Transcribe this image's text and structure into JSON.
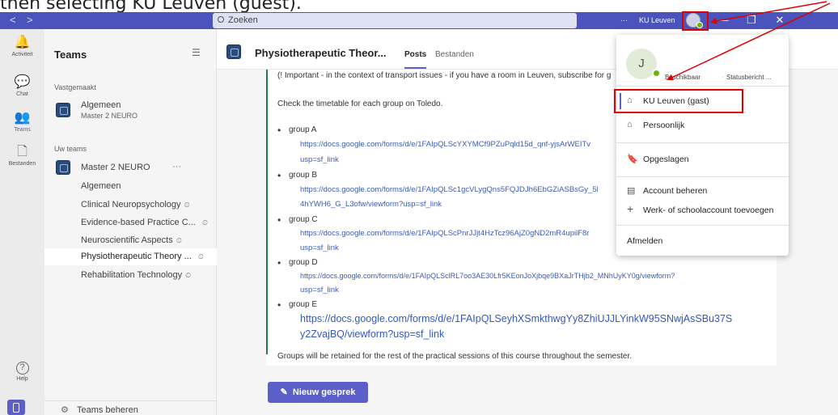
{
  "caption": "then selecting KU Leuven (guest).",
  "titlebar": {
    "back": "<",
    "forward": ">",
    "search_placeholder": "Zoeken",
    "more": "···",
    "org_name": "KU Leuven",
    "minimize": "—",
    "restore": "❐",
    "close": "✕"
  },
  "rail": {
    "items": [
      {
        "label": "Activiteit",
        "icon": "bell-icon",
        "glyph": "🔔"
      },
      {
        "label": "Chat",
        "icon": "chat-icon",
        "glyph": "💬"
      },
      {
        "label": "Teams",
        "icon": "teams-icon",
        "glyph": "👥"
      },
      {
        "label": "Bestanden",
        "icon": "file-icon",
        "glyph": "🗋"
      }
    ],
    "help": "Help",
    "help_glyph": "?"
  },
  "sidebar": {
    "title": "Teams",
    "filter_glyph": "☰",
    "pinned_label": "Vastgemaakt",
    "pinned": {
      "title": "Algemeen",
      "subtitle": "Master 2 NEURO"
    },
    "your_teams_label": "Uw teams",
    "team": {
      "name": "Master 2 NEURO",
      "more": "···"
    },
    "channels": [
      {
        "label": "Algemeen",
        "lock": ""
      },
      {
        "label": "Clinical Neuropsychology",
        "lock": "⏲"
      },
      {
        "label": "Evidence-based Practice C...",
        "lock": "⏲"
      },
      {
        "label": "Neuroscientific Aspects",
        "lock": "⏲"
      },
      {
        "label": "Physiotherapeutic Theory ...",
        "lock": "⏲"
      },
      {
        "label": "Rehabilitation Technology",
        "lock": "⏲"
      }
    ],
    "manage_label": "Teams beheren",
    "manage_glyph": "⚙"
  },
  "channel": {
    "title": "Physiotherapeutic Theor...",
    "tabs": [
      "Posts",
      "Bestanden"
    ]
  },
  "post": {
    "intro": "(! Important - in the context of transport issues - if you have a room in Leuven, subscribe for g",
    "timetable": "Check the timetable for each group on Toledo.",
    "groups": [
      {
        "name": "group A",
        "link1": "https://docs.google.com/forms/d/e/1FAIpQLScYXYMCf9PZuPqld15d_qnf-yjsArWEITv",
        "link2": "usp=sf_link"
      },
      {
        "name": "group B",
        "link1": "https://docs.google.com/forms/d/e/1FAIpQLSc1gcVLygQns5FQJDJh6EbGZiASBsGy_5l",
        "link2": "4hYWH6_G_L3ofw/viewform?usp=sf_link"
      },
      {
        "name": "group C",
        "link1": "https://docs.google.com/forms/d/e/1FAIpQLScPnrJJjt4HzTcz96AjZ0gND2mR4upilF8r",
        "link2": "usp=sf_link"
      },
      {
        "name": "group D",
        "link1": "https://docs.google.com/forms/d/e/1FAIpQLSclRL7oo3AE30Lfr5KEonJoXjbqe9BXaJrTHjb2_MNhUyKY0g/viewform?",
        "link2": "usp=sf_link"
      },
      {
        "name": "group E",
        "link1": "https://docs.google.com/forms/d/e/1FAIpQLSeyhXSmkthwgYy8ZhiUJJLYinkW95SNwjAsSBu37S",
        "link2": "y2ZvajBQ/viewform?usp=sf_link"
      }
    ],
    "footer": "Groups will be retained for the rest of the practical sessions of this course throughout the semester."
  },
  "new_conversation": {
    "glyph": "✎",
    "label": "Nieuw gesprek"
  },
  "account_menu": {
    "initial": "J",
    "status": "Beschikbaar",
    "status_message": "Statusbericht ...",
    "accounts": [
      {
        "label": "KU Leuven (gast)",
        "glyph": "⌂"
      },
      {
        "label": "Persoonlijk",
        "glyph": "⌂"
      }
    ],
    "saved": {
      "label": "Opgeslagen",
      "glyph": "🔖"
    },
    "manage_account": {
      "label": "Account beheren",
      "glyph": "▤"
    },
    "add_account": {
      "label": "Werk- of schoolaccount toevoegen",
      "glyph": "+"
    },
    "sign_out": "Afmelden"
  },
  "colors": {
    "brand": "#4b53bc",
    "accent": "#5b5fc7",
    "annotation": "#e00000",
    "presence": "#6bb700",
    "post_bar": "#237b4b"
  }
}
